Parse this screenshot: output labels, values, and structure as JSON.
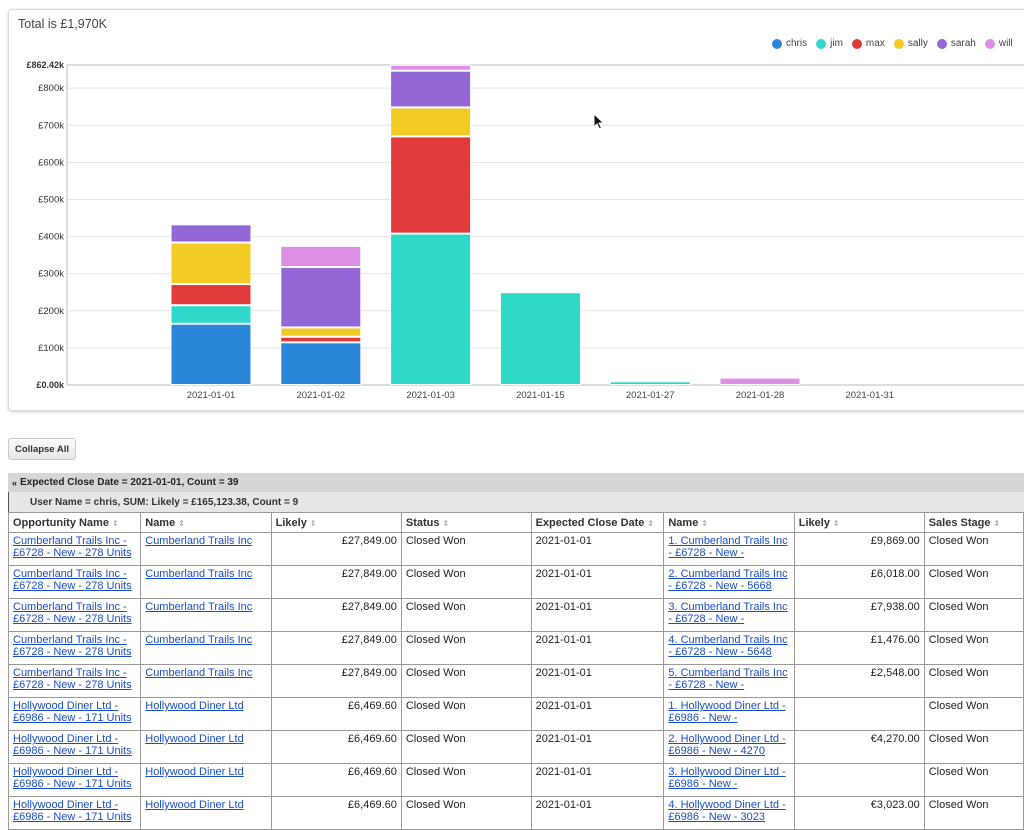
{
  "chart": {
    "title": "Total is £1,970K"
  },
  "chart_data": {
    "type": "bar",
    "stacked": true,
    "title": "Total is £1,970K",
    "xlabel": "",
    "ylabel": "",
    "ylim": [
      0,
      862.42
    ],
    "y_ticks": [
      "£0.00k",
      "£100k",
      "£200k",
      "£300k",
      "£400k",
      "£500k",
      "£600k",
      "£700k",
      "£800k",
      "£862.42k"
    ],
    "categories": [
      "2021-01-01",
      "2021-01-02",
      "2021-01-03",
      "2021-01-15",
      "2021-01-27",
      "2021-01-28",
      "2021-01-31"
    ],
    "legend_position": "top-right",
    "grid": true,
    "series": [
      {
        "name": "chris",
        "color": "#2a86d8",
        "values": [
          165,
          115,
          0,
          0,
          0,
          0,
          0
        ]
      },
      {
        "name": "jim",
        "color": "#2ed9c9",
        "values": [
          50,
          0,
          408,
          250,
          10,
          0,
          0
        ]
      },
      {
        "name": "max",
        "color": "#e03a3a",
        "values": [
          57,
          15,
          262,
          0,
          0,
          0,
          0
        ]
      },
      {
        "name": "sally",
        "color": "#f2cc24",
        "values": [
          112,
          25,
          78,
          0,
          0,
          0,
          0
        ]
      },
      {
        "name": "sarah",
        "color": "#9467d6",
        "values": [
          49,
          163,
          99,
          0,
          0,
          0,
          0
        ]
      },
      {
        "name": "will",
        "color": "#dd8fe6",
        "values": [
          0,
          57,
          16,
          0,
          0,
          20,
          0
        ]
      }
    ]
  },
  "toolbar": {
    "collapse_label": "Collapse All"
  },
  "group": {
    "chevron": "«",
    "label": "Expected Close Date = 2021-01-01, Count = 39",
    "sub_label": "User Name = chris, SUM: Likely = £165,123.38, Count = 9"
  },
  "table": {
    "sort_glyph": "⇕",
    "columns": [
      "Opportunity Name",
      "Name",
      "Likely",
      "Status",
      "Expected Close Date",
      "Name",
      "Likely",
      "Sales Stage"
    ],
    "rows": [
      {
        "opp": [
          "Cumberland Trails Inc -",
          "£6728 - New - 278 Units"
        ],
        "name": "Cumberland Trails Inc",
        "likely": "£27,849.00",
        "status": "Closed Won",
        "date": "2021-01-01",
        "name2": [
          "1. Cumberland Trails Inc",
          "- £6728 - New -"
        ],
        "likely2": "£9,869.00",
        "stage": "Closed Won"
      },
      {
        "opp": [
          "Cumberland Trails Inc -",
          "£6728 - New - 278 Units"
        ],
        "name": "Cumberland Trails Inc",
        "likely": "£27,849.00",
        "status": "Closed Won",
        "date": "2021-01-01",
        "name2": [
          "2. Cumberland Trails Inc",
          "- £6728 - New - 5668"
        ],
        "likely2": "£6,018.00",
        "stage": "Closed Won"
      },
      {
        "opp": [
          "Cumberland Trails Inc -",
          "£6728 - New - 278 Units"
        ],
        "name": "Cumberland Trails Inc",
        "likely": "£27,849.00",
        "status": "Closed Won",
        "date": "2021-01-01",
        "name2": [
          "3. Cumberland Trails Inc",
          "- £6728 - New -"
        ],
        "likely2": "£7,938.00",
        "stage": "Closed Won"
      },
      {
        "opp": [
          "Cumberland Trails Inc -",
          "£6728 - New - 278 Units"
        ],
        "name": "Cumberland Trails Inc",
        "likely": "£27,849.00",
        "status": "Closed Won",
        "date": "2021-01-01",
        "name2": [
          "4. Cumberland Trails Inc",
          "- £6728 - New - 5648"
        ],
        "likely2": "£1,476.00",
        "stage": "Closed Won"
      },
      {
        "opp": [
          "Cumberland Trails Inc -",
          "£6728 - New - 278 Units"
        ],
        "name": "Cumberland Trails Inc",
        "likely": "£27,849.00",
        "status": "Closed Won",
        "date": "2021-01-01",
        "name2": [
          "5. Cumberland Trails Inc",
          "- £6728 - New -"
        ],
        "likely2": "£2,548.00",
        "stage": "Closed Won"
      },
      {
        "opp": [
          "Hollywood Diner Ltd -",
          "£6986 - New - 171 Units"
        ],
        "name": "Hollywood Diner Ltd",
        "likely": "£6,469.60",
        "status": "Closed Won",
        "date": "2021-01-01",
        "name2": [
          "1. Hollywood Diner Ltd -",
          "£6986 - New -"
        ],
        "likely2": "",
        "stage": "Closed Won"
      },
      {
        "opp": [
          "Hollywood Diner Ltd -",
          "£6986 - New - 171 Units"
        ],
        "name": "Hollywood Diner Ltd",
        "likely": "£6,469.60",
        "status": "Closed Won",
        "date": "2021-01-01",
        "name2": [
          "2. Hollywood Diner Ltd -",
          "£6986 - New - 4270"
        ],
        "likely2": "€4,270.00",
        "stage": "Closed Won"
      },
      {
        "opp": [
          "Hollywood Diner Ltd -",
          "£6986 - New - 171 Units"
        ],
        "name": "Hollywood Diner Ltd",
        "likely": "£6,469.60",
        "status": "Closed Won",
        "date": "2021-01-01",
        "name2": [
          "3. Hollywood Diner Ltd -",
          "£6986 - New -"
        ],
        "likely2": "",
        "stage": "Closed Won"
      },
      {
        "opp": [
          "Hollywood Diner Ltd -",
          "£6986 - New - 171 Units"
        ],
        "name": "Hollywood Diner Ltd",
        "likely": "£6,469.60",
        "status": "Closed Won",
        "date": "2021-01-01",
        "name2": [
          "4. Hollywood Diner Ltd -",
          "£6986 - New - 3023"
        ],
        "likely2": "€3,023.00",
        "stage": "Closed Won"
      }
    ]
  }
}
